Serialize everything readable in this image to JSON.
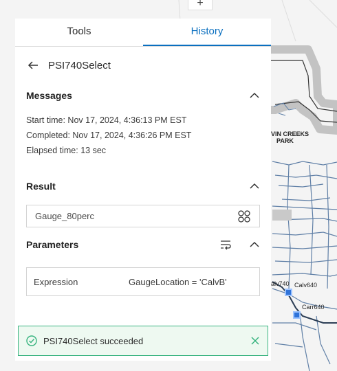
{
  "map": {
    "zoom_in": "+",
    "park_label_line1": "VIN CREEKS",
    "park_label_line2": "PARK",
    "gauge_labels": [
      "alv740",
      "Calv640",
      "Carr640"
    ]
  },
  "tabs": [
    {
      "label": "Tools",
      "active": false
    },
    {
      "label": "History",
      "active": true
    }
  ],
  "tool": {
    "title": "PSI740Select"
  },
  "messages": {
    "heading": "Messages",
    "lines": [
      "Start time: Nov 17, 2024, 4:36:13 PM EST",
      "Completed: Nov 17, 2024, 4:36:26 PM EST",
      "Elapsed time: 13 sec"
    ]
  },
  "result": {
    "heading": "Result",
    "value": "Gauge_80perc"
  },
  "parameters": {
    "heading": "Parameters",
    "rows": [
      {
        "name": "Expression",
        "value": "GaugeLocation = 'CalvB'"
      }
    ]
  },
  "toast": {
    "message": "PSI740Select succeeded",
    "color": "#36b37e"
  },
  "colors": {
    "accent": "#0a6fbf",
    "success": "#36b37e"
  }
}
